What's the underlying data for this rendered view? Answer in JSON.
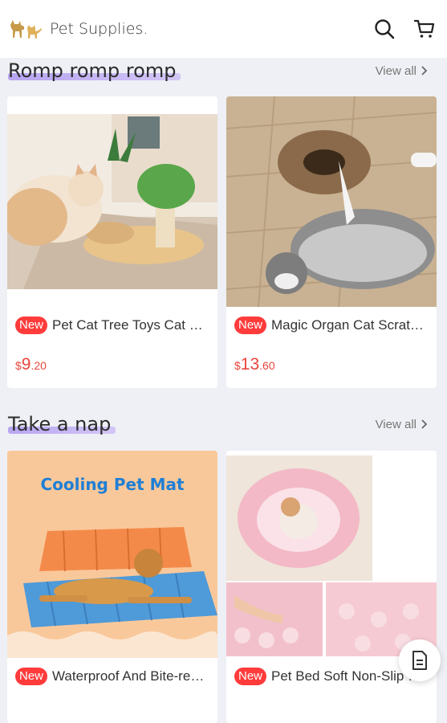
{
  "header": {
    "brand": "Pet Supplies.",
    "logo_icon": "cat-dog-logo-icon",
    "search_icon": "search-icon",
    "cart_icon": "cart-icon"
  },
  "sections": [
    {
      "title": "Romp romp romp",
      "view_all": "View all",
      "products": [
        {
          "badge": "New",
          "name": "Pet Cat Tree Toys Cat Scratcher",
          "price_symbol": "$",
          "price_int": "9",
          "price_dec": ".20"
        },
        {
          "badge": "New",
          "name": "Magic Organ Cat Scratch Board",
          "price_symbol": "$",
          "price_int": "13",
          "price_dec": ".60"
        }
      ]
    },
    {
      "title": "Take a nap",
      "view_all": "View all",
      "products": [
        {
          "badge": "New",
          "name": "Waterproof And Bite-resistant Pet Mat",
          "image_text": "Cooling Pet Mat"
        },
        {
          "badge": "New",
          "name": "Pet Bed Soft Non-Slip Round Bed"
        }
      ]
    }
  ],
  "floating_button": {
    "icon": "document-icon"
  },
  "colors": {
    "accent": "#ff3b3b",
    "price": "#e8453c",
    "highlight": "#a58cf0"
  }
}
